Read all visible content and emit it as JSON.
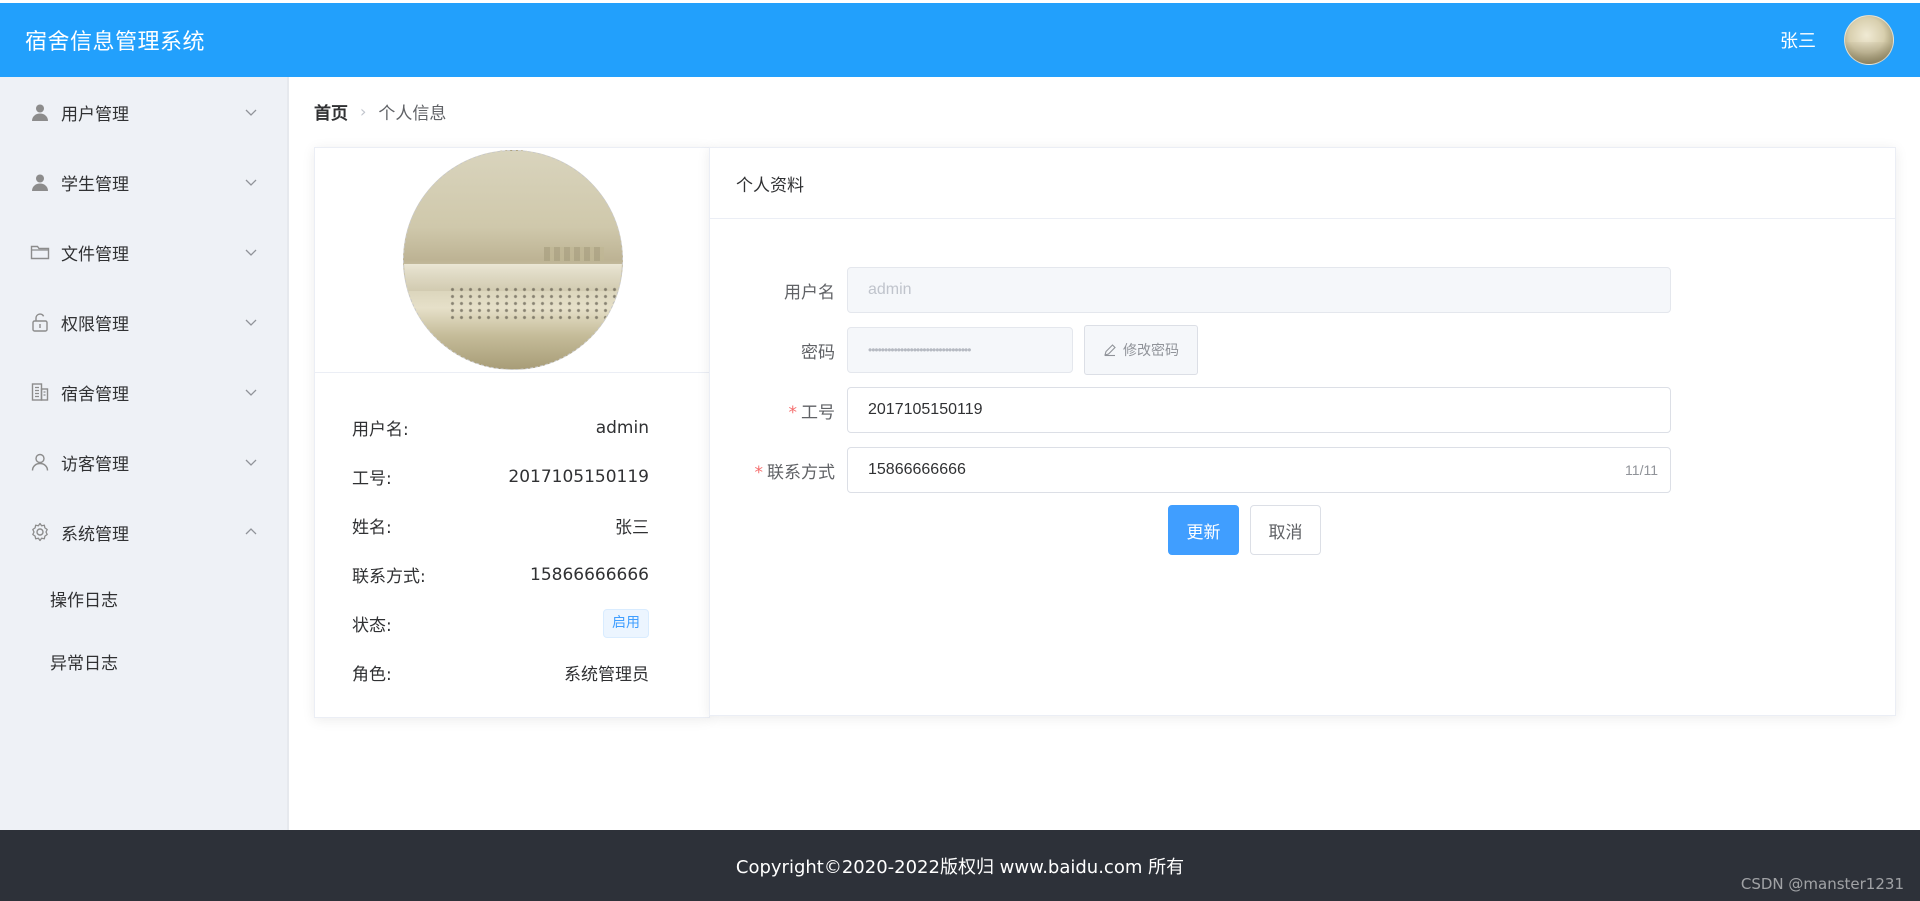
{
  "header": {
    "title": "宿舍信息管理系统",
    "user_name": "张三"
  },
  "sidebar": {
    "items": [
      {
        "label": "用户管理",
        "icon": "user-icon",
        "expanded": false
      },
      {
        "label": "学生管理",
        "icon": "user-icon",
        "expanded": false
      },
      {
        "label": "文件管理",
        "icon": "folder-icon",
        "expanded": false
      },
      {
        "label": "权限管理",
        "icon": "unlock-icon",
        "expanded": false
      },
      {
        "label": "宿舍管理",
        "icon": "building-icon",
        "expanded": false
      },
      {
        "label": "访客管理",
        "icon": "user-outline-icon",
        "expanded": false
      },
      {
        "label": "系统管理",
        "icon": "gear-icon",
        "expanded": true
      }
    ],
    "subitems": [
      {
        "label": "操作日志"
      },
      {
        "label": "异常日志"
      }
    ]
  },
  "breadcrumb": {
    "home": "首页",
    "current": "个人信息"
  },
  "profile": {
    "rows": [
      {
        "label": "用户名:",
        "value": "admin"
      },
      {
        "label": "工号:",
        "value": "2017105150119"
      },
      {
        "label": "姓名:",
        "value": "张三"
      },
      {
        "label": "联系方式:",
        "value": "15866666666"
      },
      {
        "label": "状态:",
        "value": "启用"
      },
      {
        "label": "角色:",
        "value": "系统管理员"
      }
    ]
  },
  "form": {
    "title": "个人资料",
    "username": {
      "label": "用户名",
      "placeholder": "admin"
    },
    "password": {
      "label": "密码",
      "value": "••••••••••••••••••••••••••••••••",
      "change_button": "修改密码"
    },
    "job_number": {
      "label": "工号",
      "value": "2017105150119"
    },
    "contact": {
      "label": "联系方式",
      "value": "15866666666",
      "counter": "11/11"
    },
    "update_button": "更新",
    "cancel_button": "取消"
  },
  "footer": {
    "copyright": "Copyright©2020-2022版权归 www.baidu.com 所有",
    "watermark": "CSDN @manster1231"
  },
  "colors": {
    "header_bg": "#22a0fc",
    "sidebar_bg": "#eef1f6",
    "primary": "#409eff",
    "footer_bg": "#2d3139",
    "required": "#f56c6c"
  }
}
